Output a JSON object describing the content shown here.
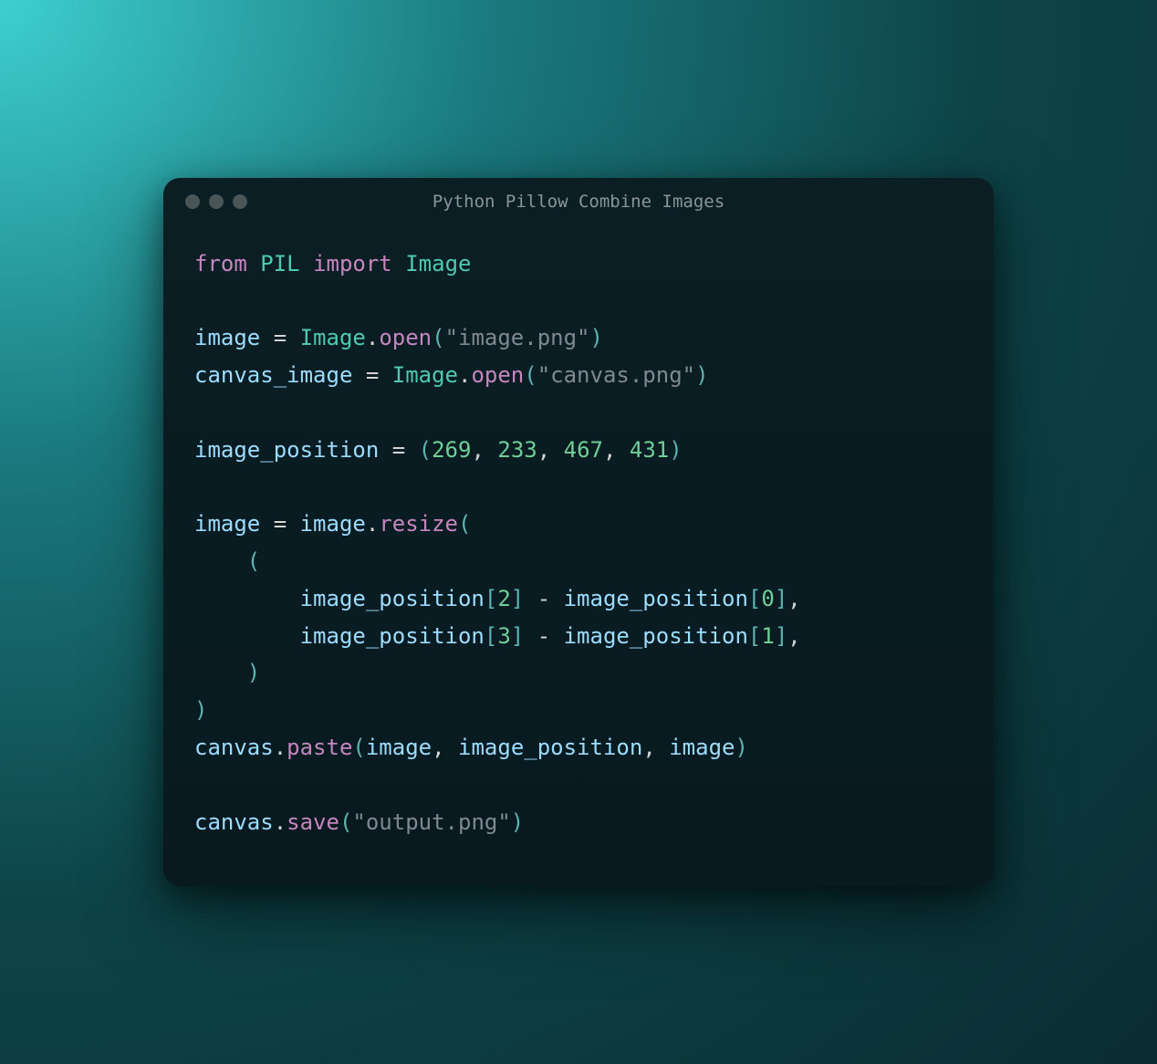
{
  "window": {
    "title": "Python Pillow Combine Images"
  },
  "code": {
    "keywords": {
      "from": "from",
      "import": "import"
    },
    "modules": {
      "pil": "PIL",
      "image_class": "Image"
    },
    "vars": {
      "image": "image",
      "canvas_image": "canvas_image",
      "image_position": "image_position",
      "canvas": "canvas"
    },
    "funcs": {
      "open": "open",
      "resize": "resize",
      "paste": "paste",
      "save": "save"
    },
    "strings": {
      "image_png": "\"image.png\"",
      "canvas_png": "\"canvas.png\"",
      "output_png": "\"output.png\""
    },
    "numbers": {
      "n269": "269",
      "n233": "233",
      "n467": "467",
      "n431": "431",
      "n2": "2",
      "n0": "0",
      "n3": "3",
      "n1": "1"
    },
    "punct": {
      "eq": " = ",
      "dot": ".",
      "comma": ", ",
      "comma_trail": ",",
      "minus": " - "
    },
    "parens": {
      "open": "(",
      "close": ")"
    },
    "brackets": {
      "open": "[",
      "close": "]"
    }
  }
}
